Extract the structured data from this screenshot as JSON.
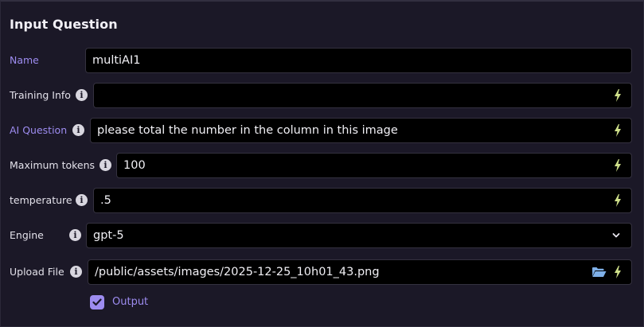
{
  "form": {
    "title": "Input Question",
    "fields": [
      {
        "label": "Name",
        "value": ""
      },
      {
        "label": "Training Info",
        "value": ""
      },
      {
        "label": "AI Question",
        "value": "please total the number in the column in this image"
      },
      {
        "label": "Maximum tokens",
        "value": "100"
      },
      {
        "label": "temperature",
        "value": ".5"
      },
      {
        "label": "Engine",
        "value": "gpt-5"
      },
      {
        "label": "Upload File",
        "value": "/public/assets/images/2025-12-25_10h01_43.png"
      }
    ],
    "name_value": "multiAI1",
    "output_checkbox": {
      "label": "Output",
      "checked": true
    }
  },
  "colors": {
    "accent": "#9d8cf0",
    "bolt": "#cfe08a",
    "folder": "#7fb0e8",
    "background": "#1b1827",
    "field_bg": "#000000"
  },
  "icons": {
    "info": "info-circle-icon",
    "bolt": "lightning-bolt-icon",
    "dropdown": "chevron-down-icon",
    "folder": "folder-open-icon",
    "check": "checkmark-icon"
  }
}
